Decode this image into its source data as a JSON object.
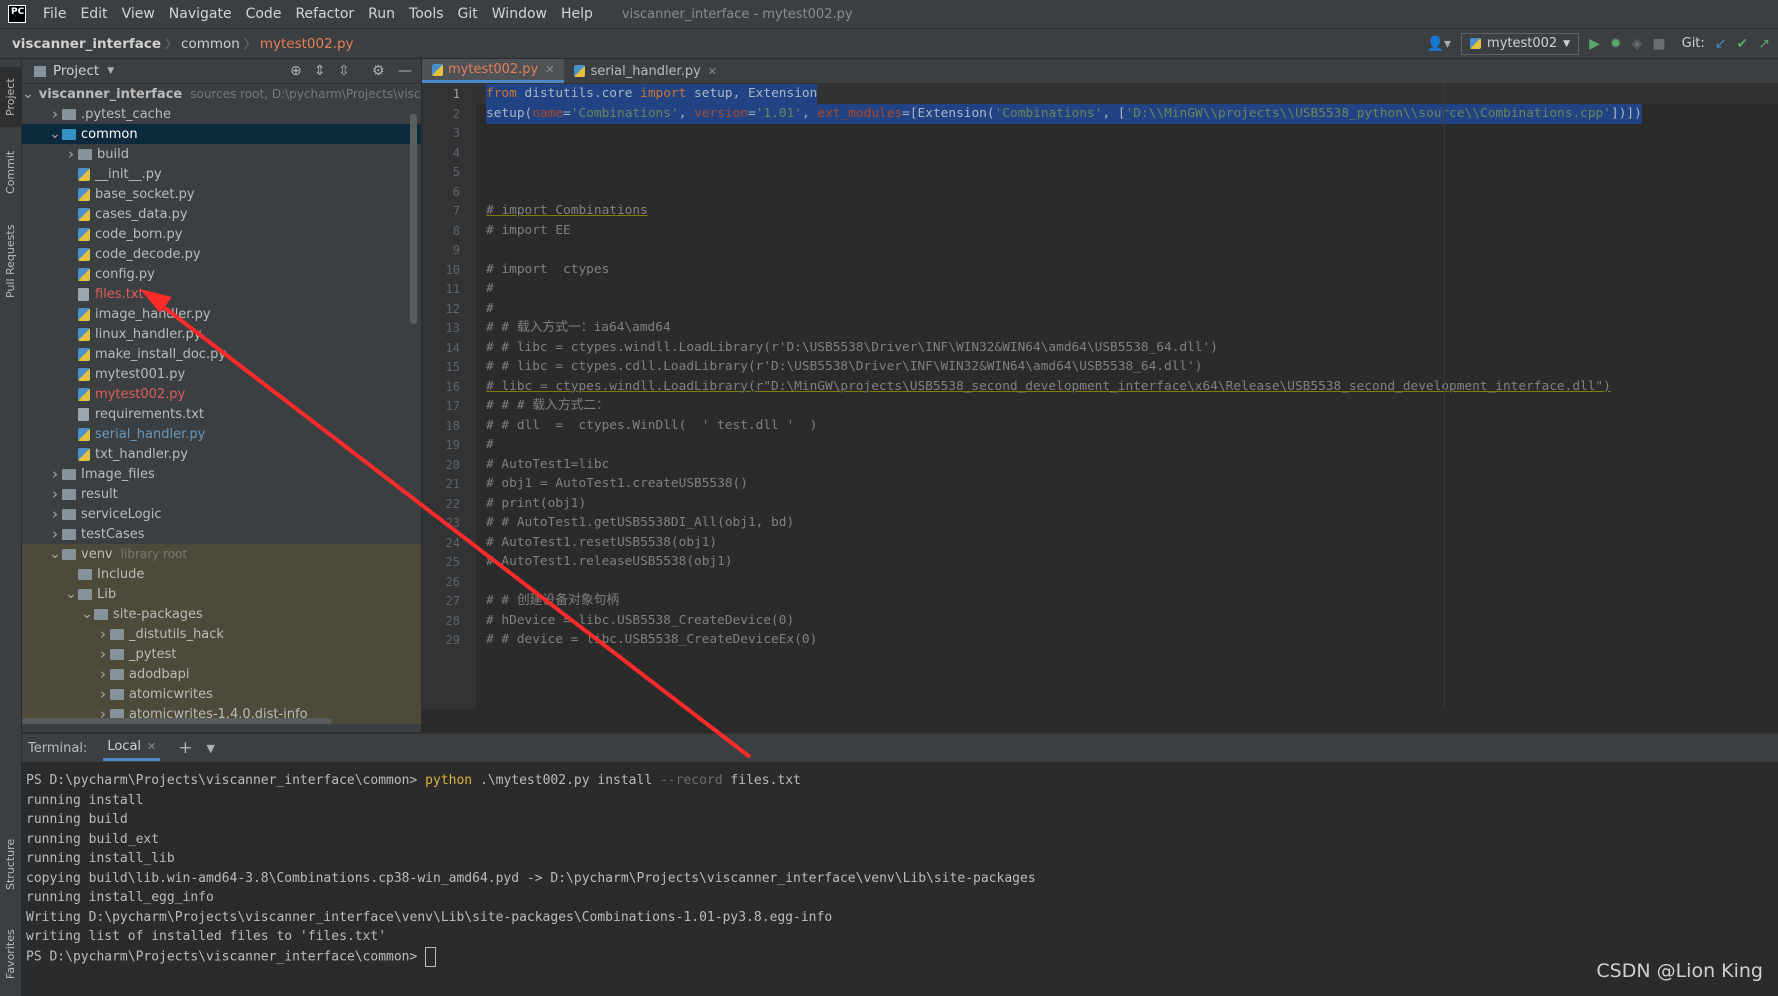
{
  "menubar": {
    "logo": "PC",
    "items": [
      "File",
      "Edit",
      "View",
      "Navigate",
      "Code",
      "Refactor",
      "Run",
      "Tools",
      "Git",
      "Window",
      "Help"
    ],
    "window_title": "viscanner_interface - mytest002.py"
  },
  "navbar": {
    "breadcrumbs": [
      "viscanner_interface",
      "common",
      "mytest002.py"
    ],
    "run_config": "mytest002",
    "git_label": "Git:"
  },
  "left_strip": {
    "tabs": [
      "Project",
      "Commit",
      "Pull Requests",
      "Structure",
      "Favorites"
    ]
  },
  "project_panel": {
    "title": "Project",
    "tree": [
      {
        "label": "viscanner_interface",
        "hint": "sources root,  D:\\pycharm\\Projects\\visca",
        "type": "folder",
        "depth": 0,
        "open": true,
        "bold": true
      },
      {
        "label": ".pytest_cache",
        "type": "folder",
        "depth": 1,
        "open": false
      },
      {
        "label": "common",
        "type": "folder-blue",
        "depth": 1,
        "open": true,
        "selected": true
      },
      {
        "label": "build",
        "type": "folder",
        "depth": 2,
        "open": false
      },
      {
        "label": "__init__.py",
        "type": "py",
        "depth": 2
      },
      {
        "label": "base_socket.py",
        "type": "py",
        "depth": 2
      },
      {
        "label": "cases_data.py",
        "type": "py",
        "depth": 2
      },
      {
        "label": "code_born.py",
        "type": "py",
        "depth": 2
      },
      {
        "label": "code_decode.py",
        "type": "py",
        "depth": 2
      },
      {
        "label": "config.py",
        "type": "py",
        "depth": 2
      },
      {
        "label": "files.txt",
        "type": "txt",
        "depth": 2,
        "color": "red"
      },
      {
        "label": "image_handler.py",
        "type": "py",
        "depth": 2
      },
      {
        "label": "linux_handler.py",
        "type": "py",
        "depth": 2
      },
      {
        "label": "make_install_doc.py",
        "type": "py",
        "depth": 2
      },
      {
        "label": "mytest001.py",
        "type": "py",
        "depth": 2
      },
      {
        "label": "mytest002.py",
        "type": "py",
        "depth": 2,
        "color": "red"
      },
      {
        "label": "requirements.txt",
        "type": "txt",
        "depth": 2
      },
      {
        "label": "serial_handler.py",
        "type": "py",
        "depth": 2,
        "color": "blue"
      },
      {
        "label": "txt_handler.py",
        "type": "py",
        "depth": 2
      },
      {
        "label": "Image_files",
        "type": "folder",
        "depth": 1,
        "open": false
      },
      {
        "label": "result",
        "type": "folder",
        "depth": 1,
        "open": false
      },
      {
        "label": "serviceLogic",
        "type": "folder",
        "depth": 1,
        "open": false
      },
      {
        "label": "testCases",
        "type": "folder",
        "depth": 1,
        "open": false
      },
      {
        "label": "venv",
        "hint": "library root",
        "type": "folder",
        "depth": 1,
        "open": true,
        "lib": true
      },
      {
        "label": "Include",
        "type": "folder",
        "depth": 2,
        "lib": true
      },
      {
        "label": "Lib",
        "type": "folder",
        "depth": 2,
        "open": true,
        "lib": true
      },
      {
        "label": "site-packages",
        "type": "folder",
        "depth": 3,
        "open": true,
        "lib": true
      },
      {
        "label": "_distutils_hack",
        "type": "folder",
        "depth": 4,
        "open": false,
        "lib": true
      },
      {
        "label": "_pytest",
        "type": "folder",
        "depth": 4,
        "open": false,
        "lib": true
      },
      {
        "label": "adodbapi",
        "type": "folder",
        "depth": 4,
        "open": false,
        "lib": true
      },
      {
        "label": "atomicwrites",
        "type": "folder",
        "depth": 4,
        "open": false,
        "lib": true
      },
      {
        "label": "atomicwrites-1.4.0.dist-info",
        "type": "folder",
        "depth": 4,
        "open": false,
        "lib": true
      }
    ]
  },
  "editor": {
    "tabs": [
      {
        "label": "mytest002.py",
        "active": true
      },
      {
        "label": "serial_handler.py",
        "active": false
      }
    ],
    "lines": [
      [
        [
          "kw",
          "from "
        ],
        [
          "",
          "distutils.core "
        ],
        [
          "kw",
          "import "
        ],
        [
          "",
          "setup, Extension"
        ]
      ],
      [
        [
          "",
          "setup("
        ],
        [
          "prm",
          "name"
        ],
        [
          "",
          "="
        ],
        [
          "str",
          "'Combinations'"
        ],
        [
          "",
          ", "
        ],
        [
          "prm",
          "version"
        ],
        [
          "",
          "="
        ],
        [
          "str",
          "'1.01'"
        ],
        [
          "",
          ", "
        ],
        [
          "prm",
          "ext_modules"
        ],
        [
          "",
          "=[Extension("
        ],
        [
          "str",
          "'Combinations'"
        ],
        [
          "",
          ", ["
        ],
        [
          "str",
          "'D:\\\\MinGW\\\\projects\\\\USB5538_python\\\\source\\\\Combinations.cpp'"
        ],
        [
          "",
          "])])"
        ]
      ],
      [],
      [],
      [],
      [],
      [
        [
          "cm",
          "# import Combinations"
        ]
      ],
      [
        [
          "cm",
          "# import EE"
        ]
      ],
      [],
      [
        [
          "cm",
          "# import  ctypes"
        ]
      ],
      [
        [
          "cm",
          "#"
        ]
      ],
      [
        [
          "cm",
          "#"
        ]
      ],
      [
        [
          "cm",
          "# # 载入方式一：ia64\\amd64"
        ]
      ],
      [
        [
          "cm",
          "# # libc = ctypes.windll.LoadLibrary(r'D:\\USB5538\\Driver\\INF\\WIN32&WIN64\\amd64\\USB5538_64.dll')"
        ]
      ],
      [
        [
          "cm",
          "# # libc = ctypes.cdll.LoadLibrary(r'D:\\USB5538\\Driver\\INF\\WIN32&WIN64\\amd64\\USB5538_64.dll')"
        ]
      ],
      [
        [
          "cm",
          "# libc = ctypes.windll.LoadLibrary(r\"D:\\MinGW\\projects\\USB5538_second_development_interface\\x64\\Release\\USB5538_second_development_interface.dll\")"
        ]
      ],
      [
        [
          "cm",
          "# # # 载入方式二："
        ]
      ],
      [
        [
          "cm",
          "# # dll  =  ctypes.WinDll(  ' test.dll '  )"
        ]
      ],
      [
        [
          "cm",
          "#"
        ]
      ],
      [
        [
          "cm",
          "# AutoTest1=libc"
        ]
      ],
      [
        [
          "cm",
          "# obj1 = AutoTest1.createUSB5538()"
        ]
      ],
      [
        [
          "cm",
          "# print(obj1)"
        ]
      ],
      [
        [
          "cm",
          "# # AutoTest1.getUSB5538DI_All(obj1, bd)"
        ]
      ],
      [
        [
          "cm",
          "# AutoTest1.resetUSB5538(obj1)"
        ]
      ],
      [
        [
          "cm",
          "# AutoTest1.releaseUSB5538(obj1)"
        ]
      ],
      [],
      [
        [
          "cm",
          "# # 创建设备对象句柄"
        ]
      ],
      [
        [
          "cm",
          "# hDevice = libc.USB5538_CreateDevice(0)"
        ]
      ],
      [
        [
          "cm",
          "# # device = libc.USB5538_CreateDeviceEx(0)"
        ]
      ]
    ]
  },
  "terminal": {
    "label": "Terminal:",
    "tab": "Local",
    "lines": [
      [
        [
          "",
          "PS D:\\pycharm\\Projects\\viscanner_interface\\common> "
        ],
        [
          "ty",
          "python"
        ],
        [
          "",
          " .\\mytest002.py install "
        ],
        [
          "tg",
          "--record"
        ],
        [
          "",
          " files.txt"
        ]
      ],
      [
        [
          "",
          "running install"
        ]
      ],
      [
        [
          "",
          "running build"
        ]
      ],
      [
        [
          "",
          "running build_ext"
        ]
      ],
      [
        [
          "",
          "running install_lib"
        ]
      ],
      [
        [
          "",
          "copying build\\lib.win-amd64-3.8\\Combinations.cp38-win_amd64.pyd -> D:\\pycharm\\Projects\\viscanner_interface\\venv\\Lib\\site-packages"
        ]
      ],
      [
        [
          "",
          "running install_egg_info"
        ]
      ],
      [
        [
          "",
          "Writing D:\\pycharm\\Projects\\viscanner_interface\\venv\\Lib\\site-packages\\Combinations-1.01-py3.8.egg-info"
        ]
      ],
      [
        [
          "",
          "writing list of installed files to 'files.txt'"
        ]
      ],
      [
        [
          "",
          "PS D:\\pycharm\\Projects\\viscanner_interface\\common> "
        ]
      ]
    ]
  },
  "watermark": "CSDN @Lion King",
  "colors": {
    "annotation_arrow": "#ff2a2a",
    "selection": "#214283",
    "accent": "#4a88c7"
  }
}
